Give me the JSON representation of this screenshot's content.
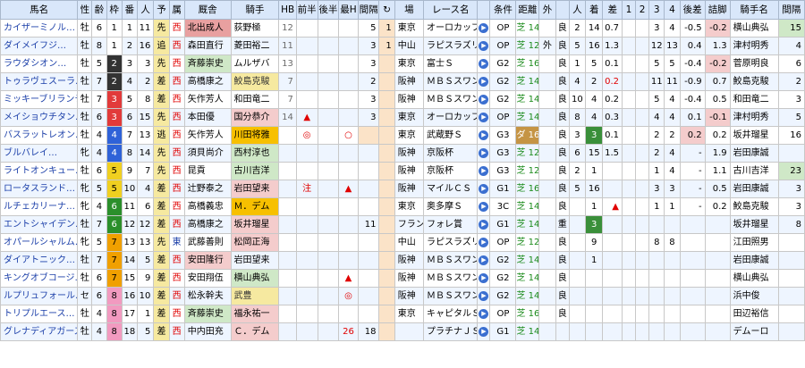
{
  "headers": [
    "馬名",
    "性",
    "齢",
    "枠",
    "番",
    "人",
    "予",
    "属",
    "厩舎",
    "騎手",
    "HB",
    "前半",
    "後半",
    "最H",
    "間隔",
    "↻",
    "場",
    "レース名",
    "",
    "条件",
    "距離",
    "外",
    "",
    "人",
    "着",
    "差",
    "1",
    "2",
    "3",
    "4",
    "後差",
    "詰脚",
    "騎手名",
    "間隔"
  ],
  "rows": [
    {
      "name": "カイザーミノル…",
      "sex": "牡",
      "age": "6",
      "waku": "1",
      "waku_bg": "#ffffff",
      "waku_fg": "#000",
      "ban": "1",
      "ninki": "11",
      "yo": "先",
      "zoku": "西",
      "kyusha": "北出成人",
      "kyusha_hl": "pinkd",
      "kishu": "荻野極",
      "kishu_hl": "",
      "hb": "12",
      "zen": "",
      "kou": "",
      "saih": "",
      "kankaku": "5",
      "kk_bg": "",
      "mark": "1",
      "ba": "東京",
      "race": "オーロカップ",
      "jouken": "OP",
      "course": "芝",
      "dist": "1400",
      "soto": "",
      "baba": "良",
      "pn": "2",
      "chaku": "14",
      "chaku_bg": "",
      "sa": "0.7",
      "sa_color": "",
      "p1": "",
      "p2": "",
      "p3": "3",
      "p4": "4",
      "gosa": "-0.5",
      "gosa_bg": "",
      "tsume": "-0.2",
      "tsume_bg": "pink",
      "jname": "横山典弘",
      "kan2": "15",
      "kan2_bg": "green2"
    },
    {
      "name": "ダイメイフジ…",
      "sex": "牡",
      "age": "8",
      "waku": "1",
      "waku_bg": "#ffffff",
      "waku_fg": "#000",
      "ban": "2",
      "ninki": "16",
      "yo": "追",
      "zoku": "西",
      "kyusha": "森田直行",
      "kyusha_hl": "",
      "kishu": "菱田裕二",
      "kishu_hl": "",
      "hb": "11",
      "zen": "",
      "kou": "",
      "saih": "",
      "kankaku": "3",
      "kk_bg": "",
      "mark": "1",
      "ba": "中山",
      "race": "ラピスラズリ",
      "jouken": "OP",
      "course": "芝",
      "dist": "1200",
      "soto": "外",
      "baba": "良",
      "pn": "5",
      "chaku": "16",
      "chaku_bg": "",
      "sa": "1.3",
      "sa_color": "",
      "p1": "",
      "p2": "",
      "p3": "12",
      "p4": "13",
      "gosa": "0.4",
      "gosa_bg": "",
      "tsume": "1.3",
      "tsume_bg": "",
      "jname": "津村明秀",
      "kan2": "4",
      "kan2_bg": ""
    },
    {
      "name": "ラウダシオン…",
      "sex": "牡",
      "age": "5",
      "waku": "2",
      "waku_bg": "#333333",
      "waku_fg": "#fff",
      "ban": "3",
      "ninki": "3",
      "yo": "先",
      "zoku": "西",
      "kyusha": "斉藤崇史",
      "kyusha_hl": "green2",
      "kishu": "ムルザバ",
      "kishu_hl": "",
      "hb": "13",
      "zen": "",
      "kou": "",
      "saih": "",
      "kankaku": "3",
      "kk_bg": "",
      "mark": "",
      "ba": "東京",
      "race": "富士Ｓ",
      "jouken": "G2",
      "course": "芝",
      "dist": "1600",
      "soto": "",
      "baba": "良",
      "pn": "1",
      "chaku": "5",
      "chaku_bg": "",
      "sa": "0.1",
      "sa_color": "",
      "p1": "",
      "p2": "",
      "p3": "5",
      "p4": "5",
      "gosa": "-0.4",
      "gosa_bg": "",
      "tsume": "-0.2",
      "tsume_bg": "pink",
      "jname": "菅原明良",
      "kan2": "6",
      "kan2_bg": ""
    },
    {
      "name": "トゥラヴェスーラ…",
      "sex": "牡",
      "age": "7",
      "waku": "2",
      "waku_bg": "#333333",
      "waku_fg": "#fff",
      "ban": "4",
      "ninki": "2",
      "yo": "差",
      "zoku": "西",
      "kyusha": "高橋康之",
      "kyusha_hl": "",
      "kishu": "鮫島克駿",
      "kishu_hl": "pred",
      "hb": "7",
      "zen": "",
      "kou": "",
      "saih": "",
      "kankaku": "2",
      "kk_bg": "",
      "mark": "",
      "ba": "阪神",
      "race": "ＭＢＳスワン",
      "jouken": "G2",
      "course": "芝",
      "dist": "1400",
      "soto": "",
      "baba": "良",
      "pn": "4",
      "chaku": "2",
      "chaku_bg": "",
      "sa": "0.2",
      "sa_color": "red",
      "p1": "",
      "p2": "",
      "p3": "11",
      "p4": "11",
      "gosa": "-0.9",
      "gosa_bg": "",
      "tsume": "0.7",
      "tsume_bg": "",
      "jname": "鮫島克駿",
      "kan2": "2",
      "kan2_bg": ""
    },
    {
      "name": "ミッキーブリランテ…",
      "sex": "牡",
      "age": "7",
      "waku": "3",
      "waku_bg": "#e23a3a",
      "waku_fg": "#fff",
      "ban": "5",
      "ninki": "8",
      "yo": "差",
      "zoku": "西",
      "kyusha": "矢作芳人",
      "kyusha_hl": "",
      "kishu": "和田竜二",
      "kishu_hl": "",
      "hb": "7",
      "zen": "",
      "kou": "",
      "saih": "",
      "kankaku": "3",
      "kk_bg": "",
      "mark": "",
      "ba": "阪神",
      "race": "ＭＢＳスワン",
      "jouken": "G2",
      "course": "芝",
      "dist": "1400",
      "soto": "",
      "baba": "良",
      "pn": "10",
      "chaku": "4",
      "chaku_bg": "",
      "sa": "0.2",
      "sa_color": "",
      "p1": "",
      "p2": "",
      "p3": "5",
      "p4": "4",
      "gosa": "-0.4",
      "gosa_bg": "",
      "tsume": "0.5",
      "tsume_bg": "",
      "jname": "和田竜二",
      "kan2": "3",
      "kan2_bg": ""
    },
    {
      "name": "メイショウチタン…",
      "sex": "牡",
      "age": "6",
      "waku": "3",
      "waku_bg": "#e23a3a",
      "waku_fg": "#fff",
      "ban": "6",
      "ninki": "15",
      "yo": "先",
      "zoku": "西",
      "kyusha": "本田優",
      "kyusha_hl": "",
      "kishu": "国分恭介",
      "kishu_hl": "pink",
      "hb": "14",
      "zen": "▲",
      "kou": "",
      "saih": "",
      "kankaku": "3",
      "kk_bg": "",
      "mark": "",
      "ba": "東京",
      "race": "オーロカップ",
      "jouken": "OP",
      "course": "芝",
      "dist": "1400",
      "soto": "",
      "baba": "良",
      "pn": "8",
      "chaku": "4",
      "chaku_bg": "",
      "sa": "0.3",
      "sa_color": "",
      "p1": "",
      "p2": "",
      "p3": "4",
      "p4": "4",
      "gosa": "0.1",
      "gosa_bg": "",
      "tsume": "-0.1",
      "tsume_bg": "pink",
      "jname": "津村明秀",
      "kan2": "5",
      "kan2_bg": ""
    },
    {
      "name": "バスラットレオン…",
      "sex": "牡",
      "age": "4",
      "waku": "4",
      "waku_bg": "#2f62d8",
      "waku_fg": "#fff",
      "ban": "7",
      "ninki": "13",
      "yo": "逃",
      "zoku": "西",
      "kyusha": "矢作芳人",
      "kyusha_hl": "",
      "kishu": "川田将雅",
      "kishu_hl": "gold",
      "hb": "",
      "zen": "◎",
      "kou": "",
      "saih": "○",
      "kankaku": "",
      "kk_bg": "hl",
      "mark": "",
      "ba": "東京",
      "race": "武蔵野Ｓ",
      "jouken": "G3",
      "course": "ダ",
      "dist": "1600",
      "soto": "",
      "baba": "良",
      "pn": "3",
      "chaku": "3",
      "chaku_bg": "green",
      "sa": "0.1",
      "sa_color": "",
      "p1": "",
      "p2": "",
      "p3": "2",
      "p4": "2",
      "gosa": "0.2",
      "gosa_bg": "pink",
      "tsume": "0.2",
      "tsume_bg": "",
      "jname": "坂井瑠星",
      "kan2": "16",
      "kan2_bg": ""
    },
    {
      "name": "ブルバレイ…",
      "sex": "牝",
      "age": "4",
      "waku": "4",
      "waku_bg": "#2f62d8",
      "waku_fg": "#fff",
      "ban": "8",
      "ninki": "14",
      "yo": "先",
      "zoku": "西",
      "kyusha": "須貝尚介",
      "kyusha_hl": "",
      "kishu": "西村淳也",
      "kishu_hl": "green2",
      "hb": "",
      "zen": "",
      "kou": "",
      "saih": "",
      "kankaku": "",
      "kk_bg": "",
      "mark": "",
      "ba": "阪神",
      "race": "京阪杯",
      "jouken": "G3",
      "course": "芝",
      "dist": "1200",
      "soto": "",
      "baba": "良",
      "pn": "6",
      "chaku": "15",
      "chaku_bg": "",
      "sa": "1.5",
      "sa_color": "",
      "p1": "",
      "p2": "",
      "p3": "2",
      "p4": "4",
      "gosa": "-",
      "gosa_bg": "",
      "tsume": "1.9",
      "tsume_bg": "",
      "jname": "岩田康誠",
      "kan2": "",
      "kan2_bg": ""
    },
    {
      "name": "ライトオンキュー…",
      "sex": "牡",
      "age": "6",
      "waku": "5",
      "waku_bg": "#f0d020",
      "waku_fg": "#000",
      "ban": "9",
      "ninki": "7",
      "yo": "先",
      "zoku": "西",
      "kyusha": "昆貢",
      "kyusha_hl": "",
      "kishu": "古川吉洋",
      "kishu_hl": "green2",
      "hb": "",
      "zen": "",
      "kou": "",
      "saih": "",
      "kankaku": "",
      "kk_bg": "",
      "mark": "",
      "ba": "阪神",
      "race": "京阪杯",
      "jouken": "G3",
      "course": "芝",
      "dist": "1200",
      "soto": "",
      "baba": "良",
      "pn": "2",
      "chaku": "1",
      "chaku_bg": "",
      "sa": "",
      "sa_color": "",
      "p1": "",
      "p2": "",
      "p3": "1",
      "p4": "4",
      "gosa": "-",
      "gosa_bg": "",
      "tsume": "1.1",
      "tsume_bg": "",
      "jname": "古川吉洋",
      "kan2": "23",
      "kan2_bg": "green2"
    },
    {
      "name": "ロータスランド…",
      "sex": "牝",
      "age": "5",
      "waku": "5",
      "waku_bg": "#f0d020",
      "waku_fg": "#000",
      "ban": "10",
      "ninki": "4",
      "yo": "差",
      "zoku": "西",
      "kyusha": "辻野泰之",
      "kyusha_hl": "",
      "kishu": "岩田望来",
      "kishu_hl": "pink",
      "hb": "",
      "zen": "注",
      "kou": "",
      "saih": "▲",
      "kankaku": "",
      "kk_bg": "",
      "mark": "",
      "ba": "阪神",
      "race": "マイルＣＳ",
      "jouken": "G1",
      "course": "芝",
      "dist": "1600",
      "soto": "",
      "baba": "良",
      "pn": "5",
      "chaku": "16",
      "chaku_bg": "",
      "sa": "",
      "sa_color": "",
      "p1": "",
      "p2": "",
      "p3": "3",
      "p4": "3",
      "gosa": "-",
      "gosa_bg": "",
      "tsume": "0.5",
      "tsume_bg": "",
      "jname": "岩田康誠",
      "kan2": "3",
      "kan2_bg": ""
    },
    {
      "name": "ルチェカリーナ…",
      "sex": "牝",
      "age": "4",
      "waku": "6",
      "waku_bg": "#2b8f2b",
      "waku_fg": "#fff",
      "ban": "11",
      "ninki": "6",
      "yo": "差",
      "zoku": "西",
      "kyusha": "高橋義忠",
      "kyusha_hl": "",
      "kishu": "Ｍ．デム",
      "kishu_hl": "gold",
      "hb": "",
      "zen": "",
      "kou": "",
      "saih": "",
      "kankaku": "",
      "kk_bg": "",
      "mark": "",
      "ba": "東京",
      "race": "奥多摩Ｓ",
      "jouken": "3C",
      "course": "芝",
      "dist": "1400",
      "soto": "",
      "baba": "良",
      "pn": "",
      "chaku": "1",
      "chaku_bg": "",
      "sa": "▲",
      "sa_color": "red",
      "p1": "",
      "p2": "",
      "p3": "1",
      "p4": "1",
      "gosa": "-",
      "gosa_bg": "",
      "tsume": "0.2",
      "tsume_bg": "",
      "jname": "鮫島克駿",
      "kan2": "3",
      "kan2_bg": ""
    },
    {
      "name": "エントシャイデン…",
      "sex": "牡",
      "age": "7",
      "waku": "6",
      "waku_bg": "#2b8f2b",
      "waku_fg": "#fff",
      "ban": "12",
      "ninki": "12",
      "yo": "差",
      "zoku": "西",
      "kyusha": "高橋康之",
      "kyusha_hl": "",
      "kishu": "坂井瑠星",
      "kishu_hl": "pink",
      "hb": "",
      "zen": "",
      "kou": "",
      "saih": "",
      "kankaku": "11",
      "kk_bg": "",
      "mark": "",
      "ba": "フランス",
      "race": "フォレ賞",
      "jouken": "G1",
      "course": "芝",
      "dist": "1400",
      "soto": "",
      "baba": "重",
      "pn": "",
      "chaku": "3",
      "chaku_bg": "green",
      "sa": "",
      "sa_color": "",
      "p1": "",
      "p2": "",
      "p3": "",
      "p4": "",
      "gosa": "",
      "gosa_bg": "",
      "tsume": "",
      "tsume_bg": "",
      "jname": "坂井瑠星",
      "kan2": "8",
      "kan2_bg": ""
    },
    {
      "name": "オパールシャルム…",
      "sex": "牝",
      "age": "5",
      "waku": "7",
      "waku_bg": "#f0a000",
      "waku_fg": "#000",
      "ban": "13",
      "ninki": "13",
      "yo": "先",
      "zoku": "東",
      "kyusha": "武藤善則",
      "kyusha_hl": "",
      "kishu": "松岡正海",
      "kishu_hl": "pink",
      "hb": "",
      "zen": "",
      "kou": "",
      "saih": "",
      "kankaku": "",
      "kk_bg": "",
      "mark": "",
      "ba": "中山",
      "race": "ラピスラズリ",
      "jouken": "OP",
      "course": "芝",
      "dist": "1200",
      "soto": "",
      "baba": "良",
      "pn": "",
      "chaku": "9",
      "chaku_bg": "",
      "sa": "",
      "sa_color": "",
      "p1": "",
      "p2": "",
      "p3": "8",
      "p4": "8",
      "gosa": "",
      "gosa_bg": "",
      "tsume": "",
      "tsume_bg": "",
      "jname": "江田照男",
      "kan2": "",
      "kan2_bg": ""
    },
    {
      "name": "ダイアトニック…",
      "sex": "牡",
      "age": "7",
      "waku": "7",
      "waku_bg": "#f0a000",
      "waku_fg": "#000",
      "ban": "14",
      "ninki": "5",
      "yo": "差",
      "zoku": "西",
      "kyusha": "安田隆行",
      "kyusha_hl": "pink",
      "kishu": "岩田望来",
      "kishu_hl": "",
      "hb": "",
      "zen": "",
      "kou": "",
      "saih": "",
      "kankaku": "",
      "kk_bg": "",
      "mark": "",
      "ba": "阪神",
      "race": "ＭＢＳスワン",
      "jouken": "G2",
      "course": "芝",
      "dist": "1400",
      "soto": "",
      "baba": "良",
      "pn": "",
      "chaku": "1",
      "chaku_bg": "",
      "sa": "",
      "sa_color": "",
      "p1": "",
      "p2": "",
      "p3": "",
      "p4": "",
      "gosa": "",
      "gosa_bg": "",
      "tsume": "",
      "tsume_bg": "",
      "jname": "岩田康誠",
      "kan2": "",
      "kan2_bg": ""
    },
    {
      "name": "キングオブコージ…",
      "sex": "牡",
      "age": "6",
      "waku": "7",
      "waku_bg": "#f0a000",
      "waku_fg": "#000",
      "ban": "15",
      "ninki": "9",
      "yo": "差",
      "zoku": "西",
      "kyusha": "安田翔伍",
      "kyusha_hl": "",
      "kishu": "横山典弘",
      "kishu_hl": "green2",
      "hb": "",
      "zen": "",
      "kou": "",
      "saih": "▲",
      "kankaku": "",
      "kk_bg": "",
      "mark": "",
      "ba": "阪神",
      "race": "ＭＢＳスワン",
      "jouken": "G2",
      "course": "芝",
      "dist": "1400",
      "soto": "",
      "baba": "良",
      "pn": "",
      "chaku": "",
      "chaku_bg": "",
      "sa": "",
      "sa_color": "",
      "p1": "",
      "p2": "",
      "p3": "",
      "p4": "",
      "gosa": "",
      "gosa_bg": "",
      "tsume": "",
      "tsume_bg": "",
      "jname": "横山典弘",
      "kan2": "",
      "kan2_bg": ""
    },
    {
      "name": "ルプリュフォール…",
      "sex": "セ",
      "age": "6",
      "waku": "8",
      "waku_bg": "#f29ac0",
      "waku_fg": "#000",
      "ban": "16",
      "ninki": "10",
      "yo": "差",
      "zoku": "西",
      "kyusha": "松永幹夫",
      "kyusha_hl": "",
      "kishu": "武豊",
      "kishu_hl": "pred",
      "hb": "",
      "zen": "",
      "kou": "",
      "saih": "◎",
      "kankaku": "",
      "kk_bg": "",
      "mark": "",
      "ba": "阪神",
      "race": "ＭＢＳスワン",
      "jouken": "G2",
      "course": "芝",
      "dist": "1400",
      "soto": "",
      "baba": "良",
      "pn": "",
      "chaku": "",
      "chaku_bg": "",
      "sa": "",
      "sa_color": "",
      "p1": "",
      "p2": "",
      "p3": "",
      "p4": "",
      "gosa": "",
      "gosa_bg": "",
      "tsume": "",
      "tsume_bg": "",
      "jname": "浜中俊",
      "kan2": "",
      "kan2_bg": ""
    },
    {
      "name": "トリプルエース…",
      "sex": "牡",
      "age": "4",
      "waku": "8",
      "waku_bg": "#f29ac0",
      "waku_fg": "#000",
      "ban": "17",
      "ninki": "1",
      "yo": "差",
      "zoku": "西",
      "kyusha": "斉藤崇史",
      "kyusha_hl": "green2",
      "kishu": "福永祐一",
      "kishu_hl": "pink",
      "hb": "",
      "zen": "",
      "kou": "",
      "saih": "",
      "kankaku": "",
      "kk_bg": "",
      "mark": "",
      "ba": "東京",
      "race": "キャピタルＳ",
      "jouken": "OP",
      "course": "芝",
      "dist": "1600",
      "soto": "",
      "baba": "良",
      "pn": "",
      "chaku": "",
      "chaku_bg": "",
      "sa": "",
      "sa_color": "",
      "p1": "",
      "p2": "",
      "p3": "",
      "p4": "",
      "gosa": "",
      "gosa_bg": "",
      "tsume": "",
      "tsume_bg": "",
      "jname": "田辺裕信",
      "kan2": "",
      "kan2_bg": ""
    },
    {
      "name": "グレナディアガーズ…",
      "sex": "牡",
      "age": "4",
      "waku": "8",
      "waku_bg": "#f29ac0",
      "waku_fg": "#000",
      "ban": "18",
      "ninki": "5",
      "yo": "差",
      "zoku": "西",
      "kyusha": "中内田充",
      "kyusha_hl": "",
      "kishu": "Ｃ．デム",
      "kishu_hl": "pink",
      "hb": "",
      "zen": "",
      "kou": "",
      "saih": "26",
      "kankaku": "18",
      "kk_bg": "",
      "mark": "",
      "ba": "",
      "race": "プラチナＪＳ",
      "jouken": "G1",
      "course": "芝",
      "dist": "1400",
      "soto": "",
      "baba": "",
      "pn": "",
      "chaku": "",
      "chaku_bg": "",
      "sa": "",
      "sa_color": "",
      "p1": "",
      "p2": "",
      "p3": "",
      "p4": "",
      "gosa": "",
      "gosa_bg": "",
      "tsume": "",
      "tsume_bg": "",
      "jname": "デムーロ",
      "kan2": "",
      "kan2_bg": ""
    }
  ]
}
